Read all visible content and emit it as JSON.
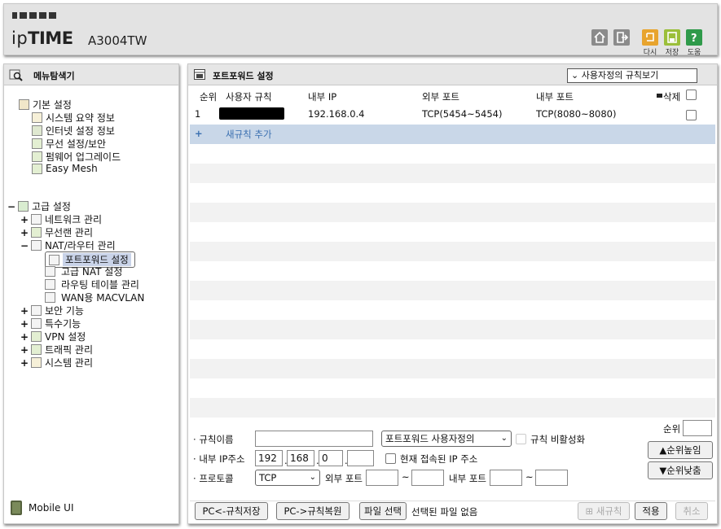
{
  "header": {
    "logo_prefix": "ip",
    "logo_bold": "TIME",
    "model": "A3004TW",
    "toolbar": [
      {
        "icon": "home-icon",
        "label": ""
      },
      {
        "icon": "logout-icon",
        "label": ""
      },
      {
        "icon": "refresh-icon",
        "label": "다시"
      },
      {
        "icon": "save-icon",
        "label": "저장"
      },
      {
        "icon": "help-icon",
        "label": "도움"
      }
    ]
  },
  "sidebar": {
    "title": "메뉴탐색기",
    "basic": {
      "label": "기본 설정",
      "items": [
        "시스템 요약 정보",
        "인터넷 설정 정보",
        "무선 설정/보안",
        "펌웨어 업그레이드",
        "Easy Mesh"
      ]
    },
    "advanced": {
      "label": "고급 설정",
      "items": [
        {
          "label": "네트워크 관리",
          "pm": "+"
        },
        {
          "label": "무선랜 관리",
          "pm": "+"
        },
        {
          "label": "NAT/라우터 관리",
          "pm": "−"
        },
        {
          "label": "보안 기능",
          "pm": "+"
        },
        {
          "label": "특수기능",
          "pm": "+"
        },
        {
          "label": "VPN 설정",
          "pm": "+"
        },
        {
          "label": "트래픽 관리",
          "pm": "+"
        },
        {
          "label": "시스템 관리",
          "pm": "+"
        }
      ],
      "nat_children": [
        "포트포워드 설정",
        "고급 NAT 설정",
        "라우팅 테이블 관리",
        "WAN용 MACVLAN"
      ]
    },
    "mobile": "Mobile UI"
  },
  "main": {
    "title": "포트포워드 설정",
    "view_select": "사용자정의 규칙보기",
    "columns": {
      "order": "순위",
      "rule": "사용자 규칙",
      "int_ip": "내부 IP",
      "ext_port": "외부 포트",
      "int_port": "내부 포트",
      "delete": "삭제"
    },
    "rows": [
      {
        "order": "1",
        "rule": "",
        "int_ip": "192.168.0.4",
        "ext_port": "TCP(5454~5454)",
        "int_port": "TCP(8080~8080)"
      }
    ],
    "add_rule": "새규칙 추가",
    "form": {
      "rule_name_label": "규칙이름",
      "rule_name_value": "",
      "preset_select": "포트포워드 사용자정의",
      "disable_label": "규칙 비활성화",
      "order_label": "순위",
      "order_value": "",
      "up_button": "순위높임",
      "down_button": "순위낮춤",
      "ip_label": "내부 IP주소",
      "ip": [
        "192",
        "168",
        "0",
        ""
      ],
      "current_ip_label": "현재 접속된 IP 주소",
      "protocol_label": "프로토콜",
      "protocol_value": "TCP",
      "ext_port_label": "외부 포트",
      "int_port_label": "내부 포트",
      "tilde": "~",
      "save_pc_button": "PC<-규칙저장",
      "restore_pc_button": "PC->규칙복원",
      "file_button": "파일 선택",
      "file_status": "선택된 파일 없음",
      "new_rule_button": "새규칙",
      "apply_button": "적용",
      "cancel_button": "취소"
    }
  }
}
